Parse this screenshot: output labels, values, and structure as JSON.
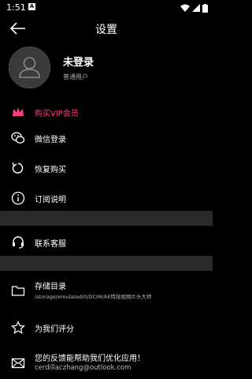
{
  "status": {
    "time": "1:51",
    "notif": "A"
  },
  "header": {
    "title": "设置"
  },
  "profile": {
    "name": "未登录",
    "type": "普通用户"
  },
  "menu": {
    "vip": "购买VIP会员",
    "wechat": "微信登录",
    "restore": "恢复购买",
    "subscription": "订阅说明",
    "support": "联系客服",
    "storage": "存储目录",
    "storage_path": "/storage/emulated/0/DCIM/AE特效视频片头大师",
    "rate": "为我们评分",
    "feedback": "您的反馈能帮助我们优化应用！",
    "feedback_email": "cerdillaczhang@outlook.com"
  },
  "colors": {
    "accent": "#ff3d7f",
    "divider": "#2a2a2a"
  }
}
